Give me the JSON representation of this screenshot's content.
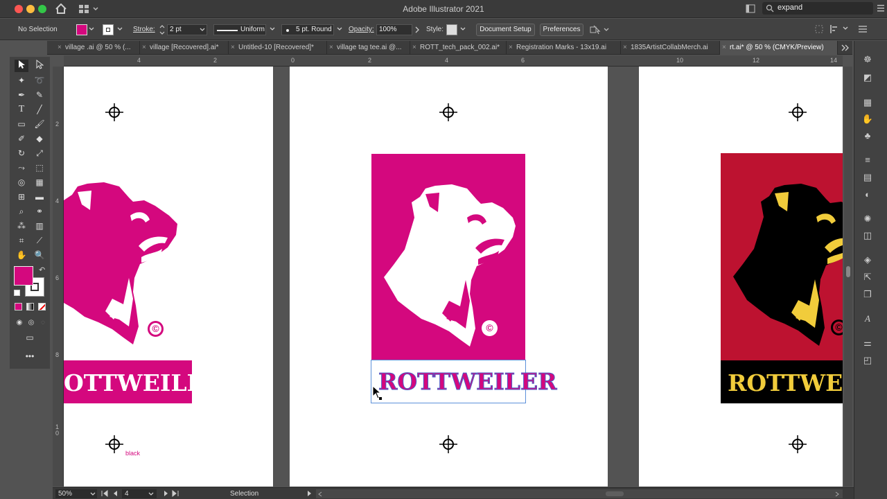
{
  "window": {
    "title": "Adobe Illustrator 2021",
    "search_value": "expand"
  },
  "control_bar": {
    "selection_label": "No Selection",
    "fill_color": "#d4087e",
    "stroke_label": "Stroke:",
    "stroke_weight": "2 pt",
    "stroke_profile": "Uniform",
    "brush": "5 pt. Round",
    "opacity_label": "Opacity:",
    "opacity_value": "100%",
    "style_label": "Style:",
    "document_setup": "Document Setup",
    "preferences": "Preferences"
  },
  "tabs": [
    {
      "label": "village .ai @ 50 % (..."
    },
    {
      "label": "village [Recovered].ai*"
    },
    {
      "label": "Untitled-10 [Recovered]*"
    },
    {
      "label": "village tag tee.ai @..."
    },
    {
      "label": "ROTT_tech_pack_002.ai*"
    },
    {
      "label": "Registration Marks - 13x19.ai"
    },
    {
      "label": "1835ArtistCollabMerch.ai"
    },
    {
      "label": "rt.ai* @ 50 % (CMYK/Preview)"
    }
  ],
  "rulers": {
    "top": [
      "4",
      "2",
      "0",
      "2",
      "4",
      "6",
      "10",
      "12",
      "14"
    ],
    "left": [
      "2",
      "4",
      "6",
      "8",
      "1\n0"
    ]
  },
  "artwork": {
    "brand_text": "ROTTWEILER",
    "partial_brand_text_left": "OTTWEILER",
    "partial_brand_text_right": "ROTTWEILE",
    "swatch_label": "black",
    "copyright_symbol": "©",
    "colors": {
      "magenta": "#d4087e",
      "red": "#bd1230",
      "yellow": "#f1cc3b",
      "black": "#000000"
    }
  },
  "status_bar": {
    "zoom": "50%",
    "artboard_number": "4",
    "tool": "Selection"
  },
  "colors": {
    "accent": "#d4087e",
    "chrome_dark": "#3a3a3a",
    "chrome": "#424242"
  }
}
